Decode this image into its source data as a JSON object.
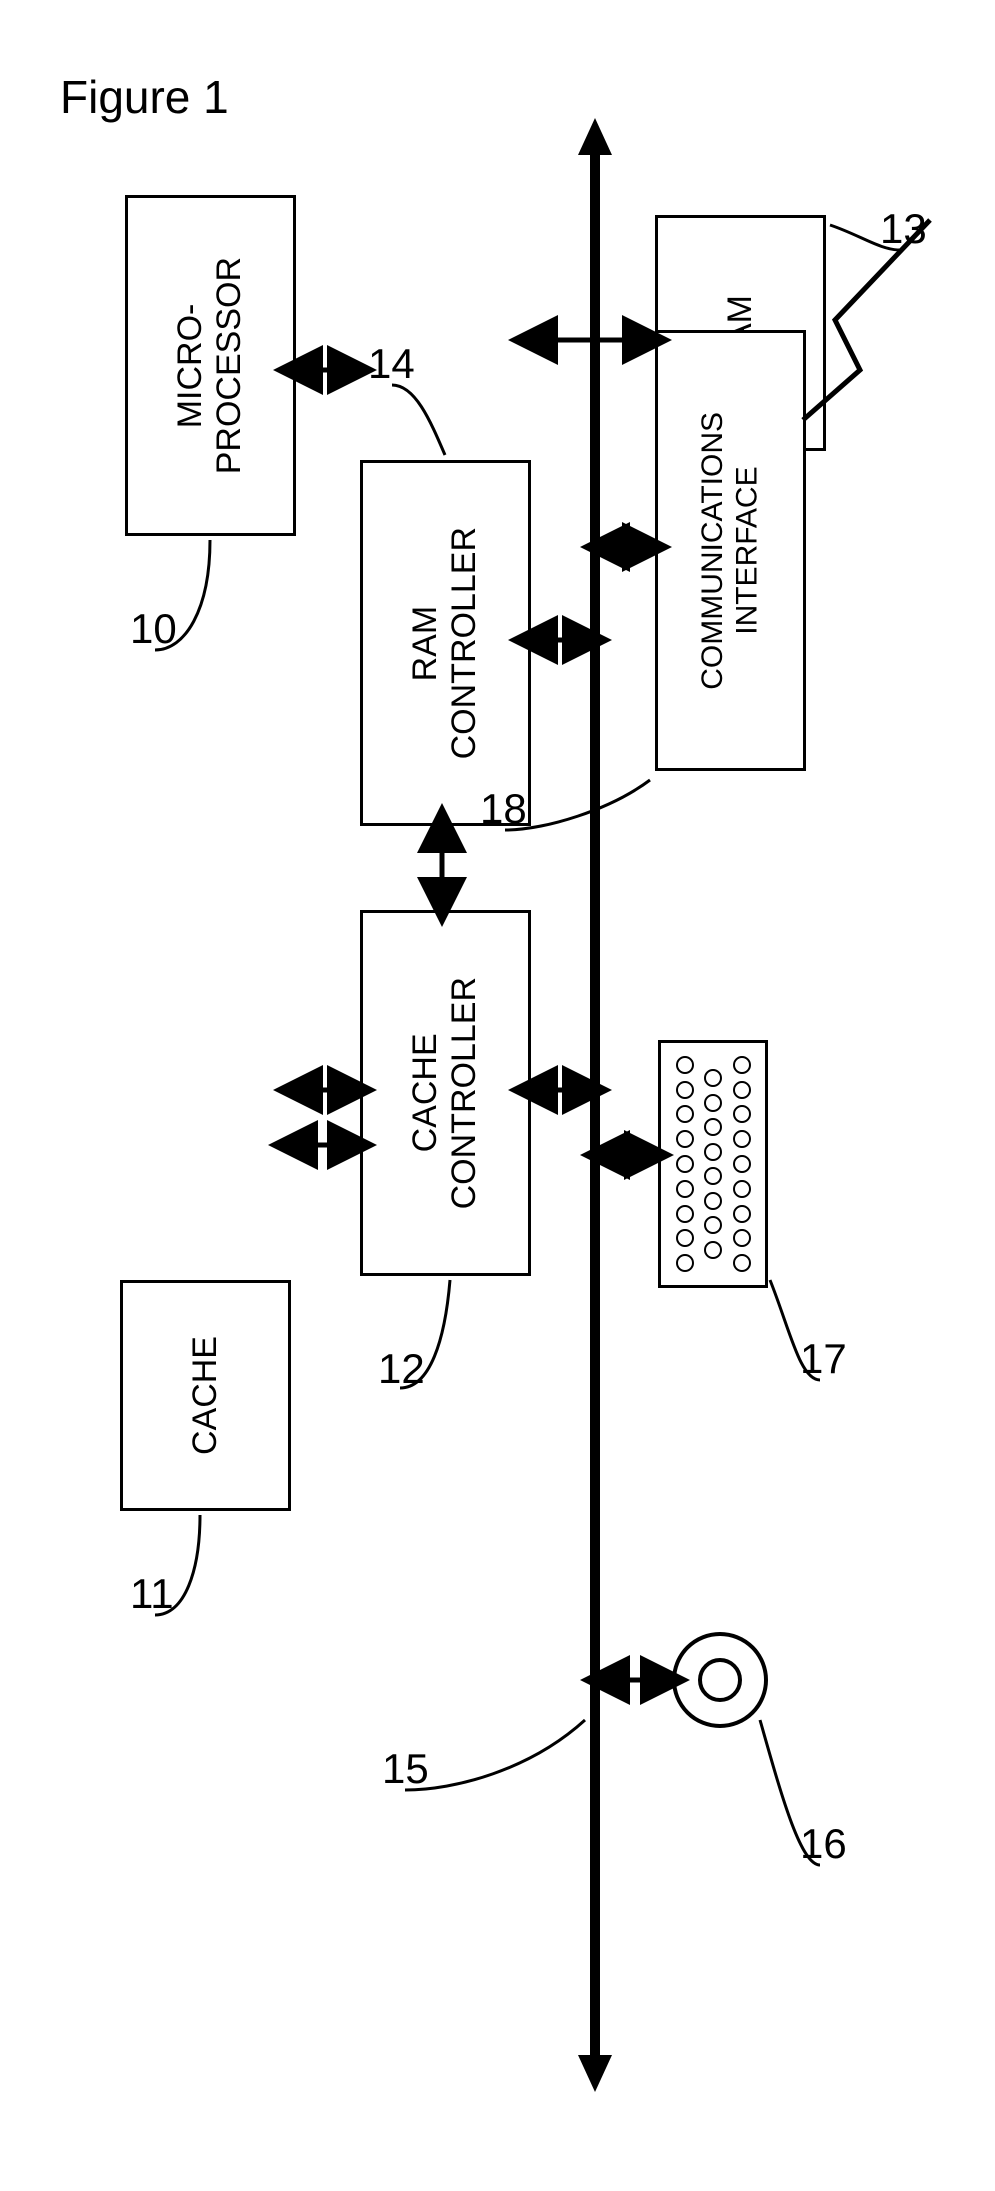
{
  "figure": {
    "title": "Figure 1"
  },
  "blocks": {
    "microprocessor": "MICRO-\nPROCESSOR",
    "cache": "CACHE",
    "cache_controller": "CACHE\nCONTROLLER",
    "ram": "RAM",
    "ram_controller": "RAM\nCONTROLLER",
    "comm_interface": "COMMUNICATIONS\nINTERFACE"
  },
  "refs": {
    "microprocessor": "10",
    "cache": "11",
    "cache_controller": "12",
    "ram": "13",
    "ram_controller": "14",
    "bus": "15",
    "disc": "16",
    "keypad": "17",
    "comm_interface": "18"
  },
  "chart_data": {
    "type": "diagram",
    "title": "Figure 1",
    "nodes": [
      {
        "id": 10,
        "label": "MICRO-PROCESSOR"
      },
      {
        "id": 11,
        "label": "CACHE"
      },
      {
        "id": 12,
        "label": "CACHE CONTROLLER"
      },
      {
        "id": 13,
        "label": "RAM"
      },
      {
        "id": 14,
        "label": "RAM CONTROLLER"
      },
      {
        "id": 15,
        "label": "bus"
      },
      {
        "id": 16,
        "label": "disc-device"
      },
      {
        "id": 17,
        "label": "keypad-device"
      },
      {
        "id": 18,
        "label": "COMMUNICATIONS INTERFACE"
      }
    ],
    "edges": [
      {
        "from": 10,
        "to": 12,
        "bidirectional": true
      },
      {
        "from": 11,
        "to": 12,
        "bidirectional": true
      },
      {
        "from": 12,
        "to": 14,
        "bidirectional": true
      },
      {
        "from": 14,
        "to": 13,
        "bidirectional": true
      },
      {
        "from": 12,
        "to": 15,
        "bidirectional": true
      },
      {
        "from": 14,
        "to": 15,
        "bidirectional": true
      },
      {
        "from": 16,
        "to": 15,
        "bidirectional": true
      },
      {
        "from": 17,
        "to": 15,
        "bidirectional": true
      },
      {
        "from": 18,
        "to": 15,
        "bidirectional": true
      },
      {
        "from": 18,
        "to": "external",
        "bidirectional": false,
        "note": "zig-zag link"
      }
    ]
  }
}
